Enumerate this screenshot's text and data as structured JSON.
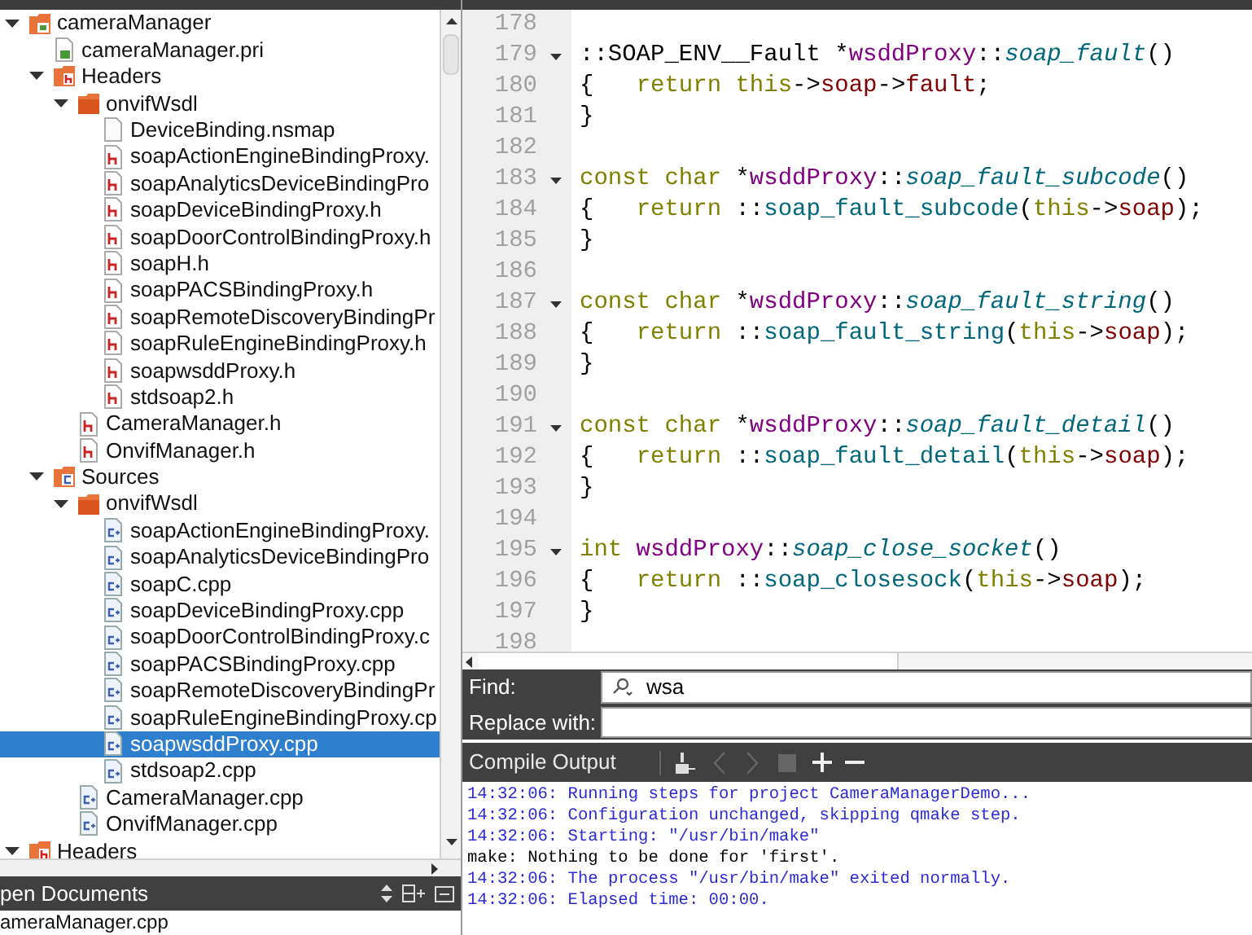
{
  "project_tree": [
    {
      "label": "cameraManager",
      "kind": "project",
      "expanded": true,
      "selected": false,
      "children": [
        {
          "label": "cameraManager.pri",
          "kind": "pri",
          "selected": false
        },
        {
          "label": "Headers",
          "kind": "headers",
          "expanded": true,
          "selected": false,
          "children": [
            {
              "label": "onvifWsdl",
              "kind": "folder",
              "expanded": true,
              "selected": false,
              "children": [
                {
                  "label": "DeviceBinding.nsmap",
                  "kind": "file",
                  "selected": false
                },
                {
                  "label": "soapActionEngineBindingProxy.",
                  "kind": "h",
                  "selected": false
                },
                {
                  "label": "soapAnalyticsDeviceBindingPro",
                  "kind": "h",
                  "selected": false
                },
                {
                  "label": "soapDeviceBindingProxy.h",
                  "kind": "h",
                  "selected": false
                },
                {
                  "label": "soapDoorControlBindingProxy.h",
                  "kind": "h",
                  "selected": false
                },
                {
                  "label": "soapH.h",
                  "kind": "h",
                  "selected": false
                },
                {
                  "label": "soapPACSBindingProxy.h",
                  "kind": "h",
                  "selected": false
                },
                {
                  "label": "soapRemoteDiscoveryBindingPr",
                  "kind": "h",
                  "selected": false
                },
                {
                  "label": "soapRuleEngineBindingProxy.h",
                  "kind": "h",
                  "selected": false
                },
                {
                  "label": "soapwsddProxy.h",
                  "kind": "h",
                  "selected": false
                },
                {
                  "label": "stdsoap2.h",
                  "kind": "h",
                  "selected": false
                }
              ]
            },
            {
              "label": "CameraManager.h",
              "kind": "h",
              "selected": false
            },
            {
              "label": "OnvifManager.h",
              "kind": "h",
              "selected": false
            }
          ]
        },
        {
          "label": "Sources",
          "kind": "sources",
          "expanded": true,
          "selected": false,
          "children": [
            {
              "label": "onvifWsdl",
              "kind": "folder",
              "expanded": true,
              "selected": false,
              "children": [
                {
                  "label": "soapActionEngineBindingProxy.",
                  "kind": "cpp",
                  "selected": false
                },
                {
                  "label": "soapAnalyticsDeviceBindingPro",
                  "kind": "cpp",
                  "selected": false
                },
                {
                  "label": "soapC.cpp",
                  "kind": "cpp",
                  "selected": false
                },
                {
                  "label": "soapDeviceBindingProxy.cpp",
                  "kind": "cpp",
                  "selected": false
                },
                {
                  "label": "soapDoorControlBindingProxy.c",
                  "kind": "cpp",
                  "selected": false
                },
                {
                  "label": "soapPACSBindingProxy.cpp",
                  "kind": "cpp",
                  "selected": false
                },
                {
                  "label": "soapRemoteDiscoveryBindingPr",
                  "kind": "cpp",
                  "selected": false
                },
                {
                  "label": "soapRuleEngineBindingProxy.cp",
                  "kind": "cpp",
                  "selected": false
                },
                {
                  "label": "soapwsddProxy.cpp",
                  "kind": "cpp",
                  "selected": true
                },
                {
                  "label": "stdsoap2.cpp",
                  "kind": "cpp",
                  "selected": false
                }
              ]
            },
            {
              "label": "CameraManager.cpp",
              "kind": "cpp",
              "selected": false
            },
            {
              "label": "OnvifManager.cpp",
              "kind": "cpp",
              "selected": false
            }
          ]
        }
      ]
    },
    {
      "label": "Headers",
      "kind": "headers",
      "expanded": true,
      "selected": false
    }
  ],
  "open_documents": {
    "title": "pen Documents",
    "items": [
      {
        "label": "ameraManager.cpp",
        "selected": false
      }
    ]
  },
  "editor": {
    "lines": [
      {
        "number": "178",
        "fold": false
      },
      {
        "number": "179",
        "fold": true,
        "tokens": [
          {
            "text": "::SOAP_ENV__Fault *",
            "kind": "plain"
          },
          {
            "text": "wsddProxy",
            "kind": "class"
          },
          {
            "text": "::",
            "kind": "plain"
          },
          {
            "text": "soap_fault",
            "kind": "function"
          },
          {
            "text": "()",
            "kind": "plain"
          }
        ]
      },
      {
        "number": "180",
        "fold": false,
        "tokens": [
          {
            "text": "{   ",
            "kind": "plain"
          },
          {
            "text": "return this",
            "kind": "keyword"
          },
          {
            "text": "->",
            "kind": "plain"
          },
          {
            "text": "soap",
            "kind": "member"
          },
          {
            "text": "->",
            "kind": "plain"
          },
          {
            "text": "fault",
            "kind": "member"
          },
          {
            "text": ";",
            "kind": "plain"
          }
        ]
      },
      {
        "number": "181",
        "fold": false,
        "tokens": [
          {
            "text": "}",
            "kind": "plain"
          }
        ]
      },
      {
        "number": "182",
        "fold": false
      },
      {
        "number": "183",
        "fold": true,
        "tokens": [
          {
            "text": "const char",
            "kind": "keyword"
          },
          {
            "text": " *",
            "kind": "plain"
          },
          {
            "text": "wsddProxy",
            "kind": "class"
          },
          {
            "text": "::",
            "kind": "plain"
          },
          {
            "text": "soap_fault_subcode",
            "kind": "function"
          },
          {
            "text": "()",
            "kind": "plain"
          }
        ]
      },
      {
        "number": "184",
        "fold": false,
        "tokens": [
          {
            "text": "{   ",
            "kind": "plain"
          },
          {
            "text": "return",
            "kind": "keyword"
          },
          {
            "text": " ::",
            "kind": "plain"
          },
          {
            "text": "soap_fault_subcode",
            "kind": "call"
          },
          {
            "text": "(",
            "kind": "plain"
          },
          {
            "text": "this",
            "kind": "keyword"
          },
          {
            "text": "->",
            "kind": "plain"
          },
          {
            "text": "soap",
            "kind": "member"
          },
          {
            "text": ");",
            "kind": "plain"
          }
        ]
      },
      {
        "number": "185",
        "fold": false,
        "tokens": [
          {
            "text": "}",
            "kind": "plain"
          }
        ]
      },
      {
        "number": "186",
        "fold": false
      },
      {
        "number": "187",
        "fold": true,
        "tokens": [
          {
            "text": "const char",
            "kind": "keyword"
          },
          {
            "text": " *",
            "kind": "plain"
          },
          {
            "text": "wsddProxy",
            "kind": "class"
          },
          {
            "text": "::",
            "kind": "plain"
          },
          {
            "text": "soap_fault_string",
            "kind": "function"
          },
          {
            "text": "()",
            "kind": "plain"
          }
        ]
      },
      {
        "number": "188",
        "fold": false,
        "tokens": [
          {
            "text": "{   ",
            "kind": "plain"
          },
          {
            "text": "return",
            "kind": "keyword"
          },
          {
            "text": " ::",
            "kind": "plain"
          },
          {
            "text": "soap_fault_string",
            "kind": "call"
          },
          {
            "text": "(",
            "kind": "plain"
          },
          {
            "text": "this",
            "kind": "keyword"
          },
          {
            "text": "->",
            "kind": "plain"
          },
          {
            "text": "soap",
            "kind": "member"
          },
          {
            "text": ");",
            "kind": "plain"
          }
        ]
      },
      {
        "number": "189",
        "fold": false,
        "tokens": [
          {
            "text": "}",
            "kind": "plain"
          }
        ]
      },
      {
        "number": "190",
        "fold": false
      },
      {
        "number": "191",
        "fold": true,
        "tokens": [
          {
            "text": "const char",
            "kind": "keyword"
          },
          {
            "text": " *",
            "kind": "plain"
          },
          {
            "text": "wsddProxy",
            "kind": "class"
          },
          {
            "text": "::",
            "kind": "plain"
          },
          {
            "text": "soap_fault_detail",
            "kind": "function"
          },
          {
            "text": "()",
            "kind": "plain"
          }
        ]
      },
      {
        "number": "192",
        "fold": false,
        "tokens": [
          {
            "text": "{   ",
            "kind": "plain"
          },
          {
            "text": "return",
            "kind": "keyword"
          },
          {
            "text": " ::",
            "kind": "plain"
          },
          {
            "text": "soap_fault_detail",
            "kind": "call"
          },
          {
            "text": "(",
            "kind": "plain"
          },
          {
            "text": "this",
            "kind": "keyword"
          },
          {
            "text": "->",
            "kind": "plain"
          },
          {
            "text": "soap",
            "kind": "member"
          },
          {
            "text": ");",
            "kind": "plain"
          }
        ]
      },
      {
        "number": "193",
        "fold": false,
        "tokens": [
          {
            "text": "}",
            "kind": "plain"
          }
        ]
      },
      {
        "number": "194",
        "fold": false
      },
      {
        "number": "195",
        "fold": true,
        "tokens": [
          {
            "text": "int",
            "kind": "keyword"
          },
          {
            "text": " wsddProxy",
            "kind": "class"
          },
          {
            "text": "::",
            "kind": "plain"
          },
          {
            "text": "soap_close_socket",
            "kind": "function"
          },
          {
            "text": "()",
            "kind": "plain"
          }
        ]
      },
      {
        "number": "196",
        "fold": false,
        "tokens": [
          {
            "text": "{   ",
            "kind": "plain"
          },
          {
            "text": "return",
            "kind": "keyword"
          },
          {
            "text": " ::",
            "kind": "plain"
          },
          {
            "text": "soap_closesock",
            "kind": "call"
          },
          {
            "text": "(",
            "kind": "plain"
          },
          {
            "text": "this",
            "kind": "keyword"
          },
          {
            "text": "->",
            "kind": "plain"
          },
          {
            "text": "soap",
            "kind": "member"
          },
          {
            "text": ");",
            "kind": "plain"
          }
        ]
      },
      {
        "number": "197",
        "fold": false,
        "tokens": [
          {
            "text": "}",
            "kind": "plain"
          }
        ]
      },
      {
        "number": "198",
        "fold": false
      }
    ]
  },
  "find_bar": {
    "find_label": "Find:",
    "find_value": "wsa",
    "replace_label": "Replace with:"
  },
  "output_pane": {
    "title": "Compile Output",
    "lines": [
      {
        "text": "14:32:06: Running steps for project CameraManagerDemo...",
        "kind": "info"
      },
      {
        "text": "14:32:06: Configuration unchanged, skipping qmake step.",
        "kind": "info"
      },
      {
        "text": "14:32:06: Starting: \"/usr/bin/make\"",
        "kind": "info"
      },
      {
        "text": "make: Nothing to be done for 'first'.",
        "kind": "plain"
      },
      {
        "text": "14:32:06: The process \"/usr/bin/make\" exited normally.",
        "kind": "info"
      },
      {
        "text": "14:32:06: Elapsed time: 00:00.",
        "kind": "info"
      }
    ]
  }
}
